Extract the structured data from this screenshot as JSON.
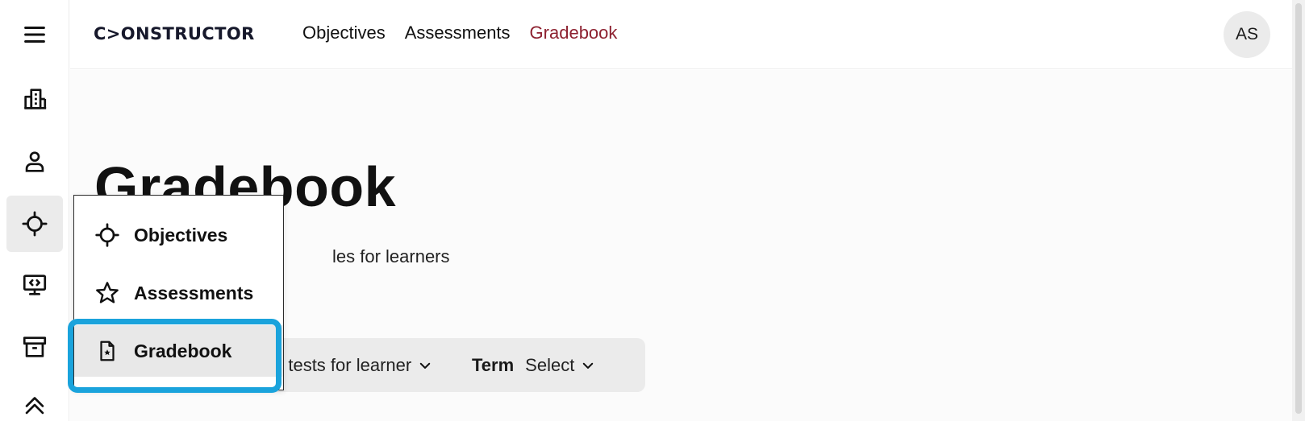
{
  "header": {
    "logo": "C>ONSTRUCTOR",
    "nav": [
      "Objectives",
      "Assessments",
      "Gradebook"
    ],
    "active_nav": "Gradebook",
    "avatar_initials": "AS"
  },
  "page": {
    "title": "Gradebook",
    "subtitle_visible": "les for learners"
  },
  "filters": {
    "first_value_visible": "g tests for learner",
    "term_label": "Term",
    "term_value": "Select"
  },
  "popover": {
    "items": [
      "Objectives",
      "Assessments",
      "Gradebook"
    ],
    "selected": "Gradebook"
  },
  "colors": {
    "accent_nav": "#8d2130",
    "highlight_ring": "#1aa3dc"
  },
  "icons": {
    "rail": [
      "menu-icon",
      "building-icon",
      "person-icon",
      "crosshair-icon",
      "monitor-code-icon",
      "archive-icon",
      "chevron-up-icon"
    ],
    "popover": [
      "crosshair-icon",
      "star-icon",
      "document-star-icon"
    ]
  }
}
